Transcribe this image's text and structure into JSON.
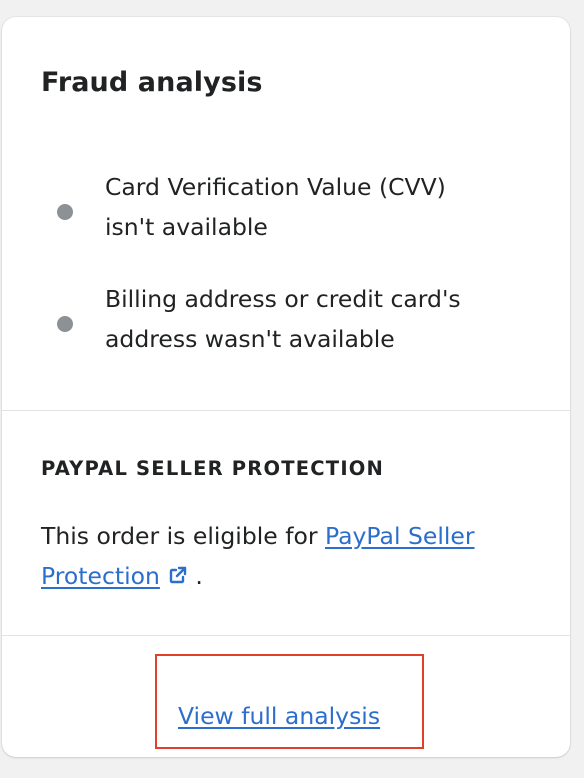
{
  "card": {
    "title": "Fraud analysis",
    "checks": [
      {
        "line1": "Card Verification Value (CVV)",
        "line2": "isn't available"
      },
      {
        "line1": "Billing address or credit card's",
        "line2": "address wasn't available"
      }
    ],
    "protection": {
      "heading": "PAYPAL SELLER PROTECTION",
      "text_before": "This order is eligible for ",
      "link_line1": "PayPal Seller",
      "link_line2": "Protection",
      "text_after": " ."
    },
    "footer_link": "View full analysis"
  },
  "colors": {
    "link": "#2c6ecb",
    "bullet": "#8c9196",
    "highlight_border": "#e0402a"
  },
  "icons": {
    "external_link": "external-link-icon",
    "bullet": "bullet-dot-icon"
  }
}
